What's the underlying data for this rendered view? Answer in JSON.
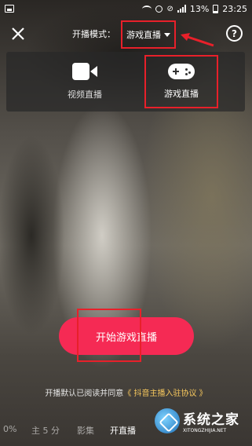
{
  "status_bar": {
    "battery_text": "13%",
    "time": "23:25"
  },
  "top_bar": {
    "mode_label": "开播模式：",
    "selected_mode": "游戏直播",
    "help_text": "?"
  },
  "mode_panel": {
    "options": [
      {
        "label": "视频直播",
        "icon": "video-camera-icon"
      },
      {
        "label": "游戏直播",
        "icon": "gamepad-icon"
      }
    ]
  },
  "start_button": {
    "label": "开始游戏直播"
  },
  "agreement": {
    "prefix": "开播默认已阅读并同意",
    "link": "《 抖音主播入驻协议 》"
  },
  "bottom_tabs": [
    "0%",
    "主  5 分",
    "影集",
    "开直播"
  ],
  "watermark": {
    "title": "系统之家",
    "url": "XITONGZHIJIA.NET"
  },
  "colors": {
    "accent": "#f52a54",
    "annotation": "#e8202a",
    "link": "#f6c75d"
  }
}
